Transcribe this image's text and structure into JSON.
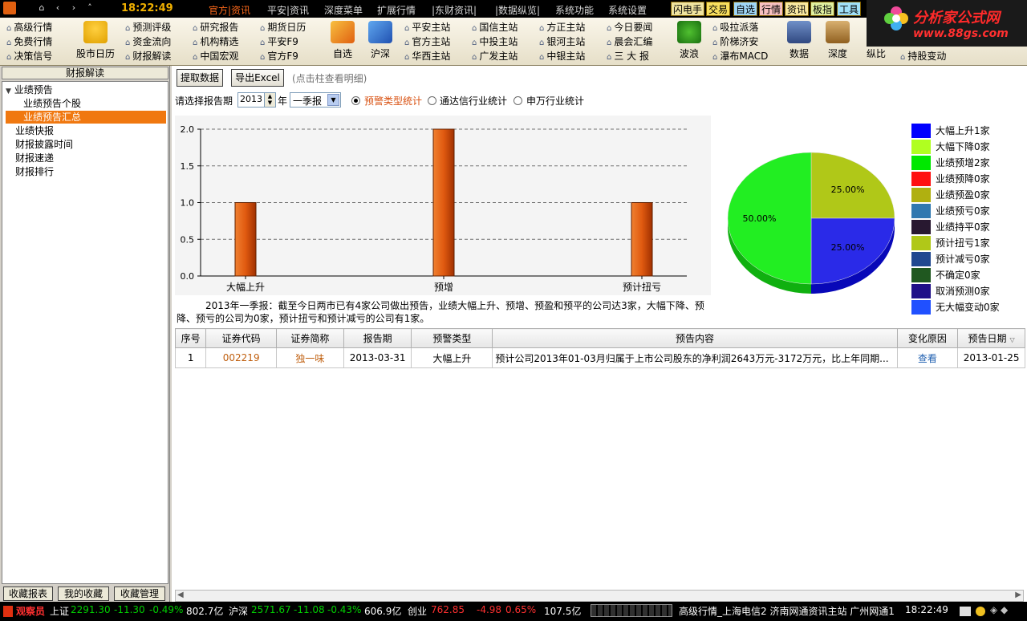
{
  "titlebar": {
    "clock": "18:22:49"
  },
  "menu": [
    "官方|资讯",
    "平安|资讯",
    "深度菜单",
    "扩展行情",
    "|东财资讯|",
    "|数据纵览|",
    "系统功能",
    "系统设置"
  ],
  "quick_buttons": [
    "闪电手",
    "交易",
    "自选",
    "行情",
    "资讯",
    "板指",
    "工具"
  ],
  "logo": {
    "line1": "分析家公式网",
    "line2": "www.88gs.com"
  },
  "toolbar": {
    "col1": [
      "高级行情",
      "免费行情",
      "决策信号"
    ],
    "big_stock_calendar": "股市日历",
    "col2": [
      "预测评级",
      "资金流向",
      "财报解读"
    ],
    "col3": [
      "研究报告",
      "机构精选",
      "中国宏观"
    ],
    "col4": [
      "期货日历",
      "平安F9",
      "官方F9"
    ],
    "big_zixuan": "自选",
    "big_hushen": "沪深",
    "col5": [
      "平安主站",
      "官方主站",
      "华西主站"
    ],
    "col6": [
      "国信主站",
      "中投主站",
      "广发主站"
    ],
    "col7": [
      "方正主站",
      "银河主站",
      "中银主站"
    ],
    "col8": [
      "今日要闻",
      "晨会汇编",
      "三 大 报"
    ],
    "big_bolang": "波浪",
    "col9": [
      "吸拉派落",
      "阶梯济安",
      "瀑布MACD"
    ],
    "big_data": "数据",
    "big_depth": "深度",
    "big_compare": "纵比",
    "col10": [
      "持股变动"
    ]
  },
  "left_panel": {
    "title": "财报解读",
    "tree": [
      "业绩预告",
      "业绩预告个股",
      "业绩预告汇总",
      "业绩快报",
      "财报披露时间",
      "财报速递",
      "财报排行"
    ],
    "buttons": [
      "收藏报表",
      "我的收藏",
      "收藏管理"
    ]
  },
  "main": {
    "btn_fetch": "提取数据",
    "btn_export": "导出Excel",
    "hint": "(点击柱查看明细)",
    "period_label": "请选择报告期",
    "year": "2013",
    "year_unit": "年",
    "quarter": "一季报",
    "radios": [
      "预警类型统计",
      "通达信行业统计",
      "申万行业统计"
    ],
    "summary": "2013年一季报：截至今日两市已有4家公司做出预告，业绩大幅上升、预增、预盈和预平的公司达3家，大幅下降、预降、预亏的公司为0家，预计扭亏和预计减亏的公司有1家。"
  },
  "colors": {
    "bar": "#e05a10",
    "pie_green": "#22ee22",
    "pie_olive": "#b0c818",
    "pie_blue": "#2a2ae8"
  },
  "chart_data": [
    {
      "type": "bar",
      "categories": [
        "大幅上升",
        "预增",
        "预计扭亏"
      ],
      "values": [
        1,
        2,
        1
      ],
      "ylim": [
        0,
        2
      ],
      "yticks": [
        "0.0",
        "0.5",
        "1.0",
        "1.5",
        "2.0"
      ],
      "grid": true
    },
    {
      "type": "pie",
      "slices": [
        {
          "label": "50.00%",
          "value": 50
        },
        {
          "label": "25.00%",
          "value": 25
        },
        {
          "label": "25.00%",
          "value": 25
        }
      ]
    }
  ],
  "legend": [
    {
      "label": "大幅上升1家",
      "color": "#0000ff"
    },
    {
      "label": "大幅下降0家",
      "color": "#b0ff20"
    },
    {
      "label": "业绩预增2家",
      "color": "#00e800"
    },
    {
      "label": "业绩预降0家",
      "color": "#ff1010"
    },
    {
      "label": "业绩预盈0家",
      "color": "#b0b010"
    },
    {
      "label": "业绩预亏0家",
      "color": "#3078b0"
    },
    {
      "label": "业绩持平0家",
      "color": "#281830"
    },
    {
      "label": "预计扭亏1家",
      "color": "#b0c818"
    },
    {
      "label": "预计减亏0家",
      "color": "#204890"
    },
    {
      "label": "不确定0家",
      "color": "#205820"
    },
    {
      "label": "取消预测0家",
      "color": "#201088"
    },
    {
      "label": "无大幅变动0家",
      "color": "#2050ff"
    }
  ],
  "table": {
    "headers": [
      "序号",
      "证券代码",
      "证券简称",
      "报告期",
      "预警类型",
      "预告内容",
      "变化原因",
      "预告日期"
    ],
    "rows": [
      [
        "1",
        "002219",
        "独一味",
        "2013-03-31",
        "大幅上升",
        "预计公司2013年01-03月归属于上市公司股东的净利润2643万元-3172万元，比上年同期...",
        "查看",
        "2013-01-25"
      ]
    ]
  },
  "status": {
    "observer": "观察员",
    "sh": {
      "name": "上证",
      "value": "2291.30",
      "chg": "-11.30",
      "pct": "-0.49%",
      "amount": "802.7亿"
    },
    "hs": {
      "name": "沪深",
      "value": "2571.67",
      "chg": "-11.08",
      "pct": "-0.43%",
      "amount": "606.9亿"
    },
    "cy": {
      "name": "创业",
      "value": "762.85",
      "chg": "-4.98",
      "pct": "0.65%",
      "amount": "107.5亿"
    },
    "info": "高级行情_上海电信2 济南网通资讯主站 广州网通1",
    "time": "18:22:49"
  }
}
